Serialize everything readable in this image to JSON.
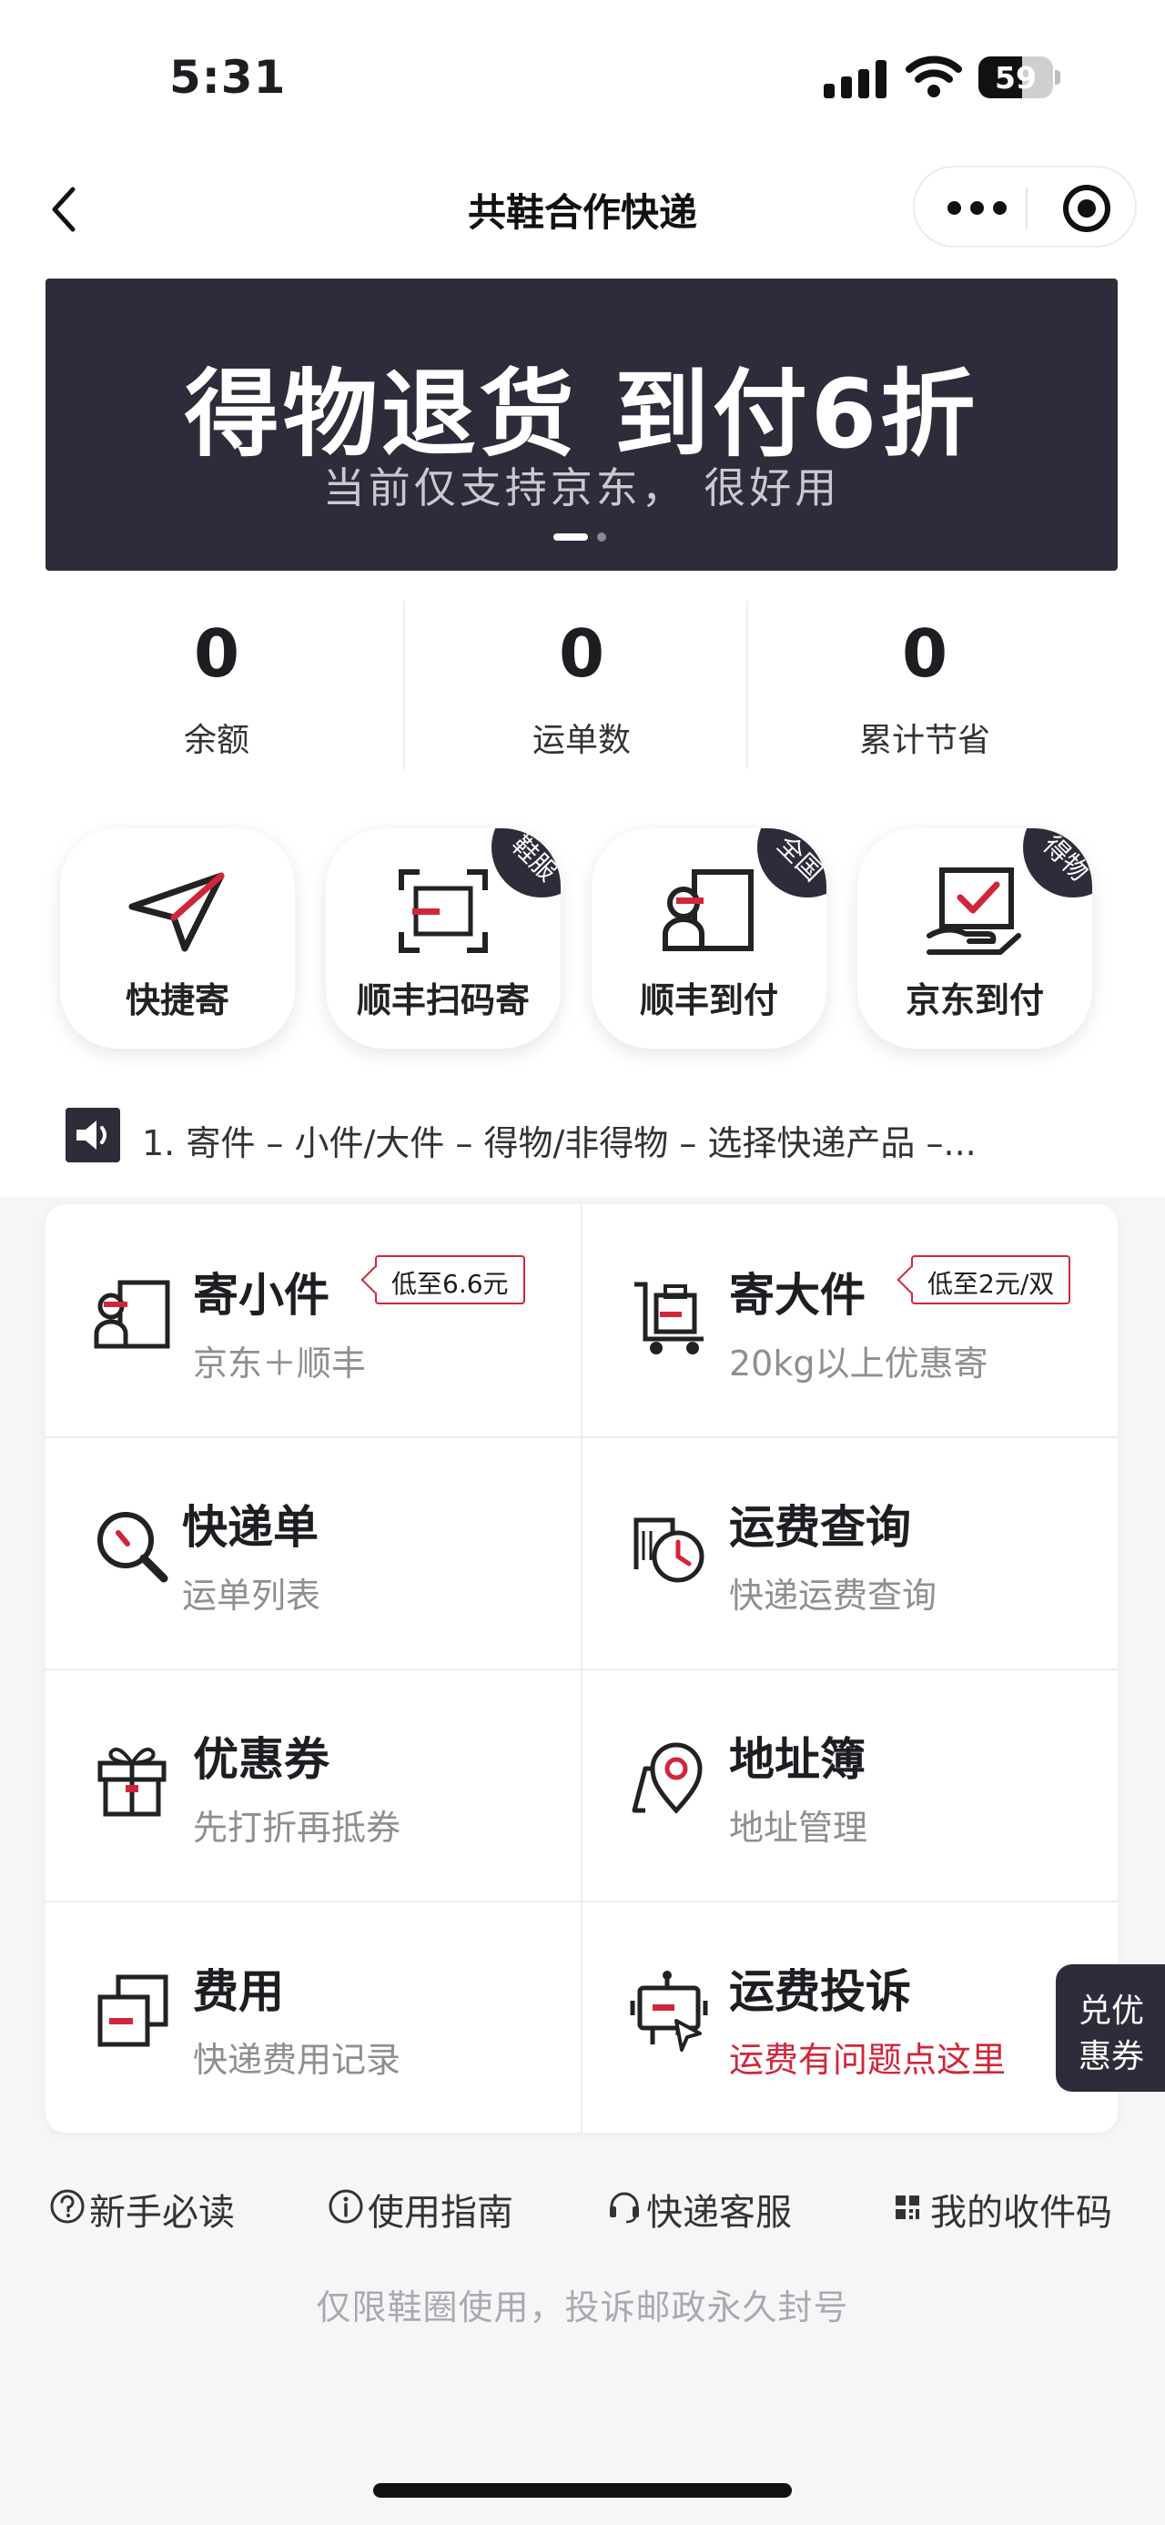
{
  "status_bar": {
    "time": "5:31",
    "battery": "59",
    "battery_level": 0.59
  },
  "nav": {
    "title": "共鞋合作快递"
  },
  "banner": {
    "title": "得物退货 到付6折",
    "subtitle": "当前仅支持京东， 很好用"
  },
  "stats": [
    {
      "value": "0",
      "label": "余额"
    },
    {
      "value": "0",
      "label": "运单数"
    },
    {
      "value": "0",
      "label": "累计节省"
    }
  ],
  "quick_actions": [
    {
      "label": "快捷寄",
      "tag": "",
      "icon": "paper-plane-icon"
    },
    {
      "label": "顺丰扫码寄",
      "tag": "鞋服",
      "icon": "scan-box-icon"
    },
    {
      "label": "顺丰到付",
      "tag": "全国",
      "icon": "package-person-icon"
    },
    {
      "label": "京东到付",
      "tag": "得物",
      "icon": "hand-box-check-icon"
    }
  ],
  "notice": {
    "text": "1. 寄件 – 小件/大件 – 得物/非得物 – 选择快递产品 –..."
  },
  "grid": [
    {
      "title": "寄小件",
      "subtitle": "京东＋顺丰",
      "badge": "低至6.6元",
      "icon": "small-package-icon"
    },
    {
      "title": "寄大件",
      "subtitle": "20kg以上优惠寄",
      "badge": "低至2元/双",
      "icon": "trolley-icon"
    },
    {
      "title": "快递单",
      "subtitle": "运单列表",
      "badge": "",
      "icon": "search-icon"
    },
    {
      "title": "运费查询",
      "subtitle": "快递运费查询",
      "badge": "",
      "icon": "clock-doc-icon"
    },
    {
      "title": "优惠券",
      "subtitle": "先打折再抵券",
      "badge": "",
      "icon": "gift-icon"
    },
    {
      "title": "地址簿",
      "subtitle": "地址管理",
      "badge": "",
      "icon": "location-pin-icon"
    },
    {
      "title": "费用",
      "subtitle": "快递费用记录",
      "badge": "",
      "icon": "stacked-doc-icon"
    },
    {
      "title": "运费投诉",
      "subtitle": "运费有问题点这里",
      "badge": "",
      "icon": "robot-cursor-icon"
    }
  ],
  "floating_coupon": {
    "line1": "兑优",
    "line2": "惠券"
  },
  "bottom_links": [
    {
      "label": "新手必读",
      "icon": "question-circle-icon"
    },
    {
      "label": "使用指南",
      "icon": "info-circle-icon"
    },
    {
      "label": "快递客服",
      "icon": "headset-icon"
    },
    {
      "label": "我的收件码",
      "icon": "qr-code-icon"
    }
  ],
  "footnote": "仅限鞋圈使用，投诉邮政永久封号",
  "colors": {
    "dark": "#2c2c3a",
    "accent_red": "#d1263a",
    "muted": "#8e8e93"
  }
}
